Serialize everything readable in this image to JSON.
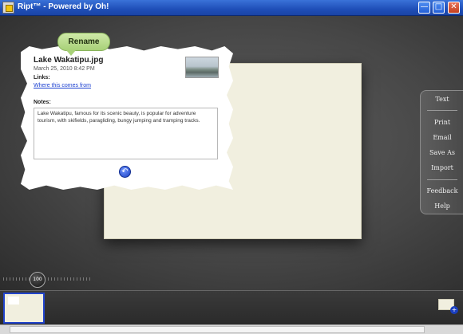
{
  "window": {
    "title": "Ript™ - Powered by Oh!",
    "buttons": {
      "minimize": "—",
      "maximize": "□",
      "close": "✕"
    }
  },
  "card": {
    "rename_label": "Rename",
    "file_name": "Lake Wakatipu.jpg",
    "date": "March 25, 2010 8:42 PM",
    "links_label": "Links:",
    "link_text": "Where this comes from",
    "notes_label": "Notes:",
    "notes_text": "Lake Wakatipu, famous for its scenic beauty, is popular for adventure tourism, with skifields, paragliding, bungy jumping and tramping tracks.",
    "back_icon": "back-arrow-icon"
  },
  "menu": {
    "items": [
      "Text",
      "Print",
      "Email",
      "Save As",
      "Import",
      "Feedback",
      "Help"
    ]
  },
  "zoom": {
    "value": "100"
  },
  "colors": {
    "accent": "#1f4fb8",
    "canvas": "#f1efdf",
    "rename": "#a8d178"
  }
}
